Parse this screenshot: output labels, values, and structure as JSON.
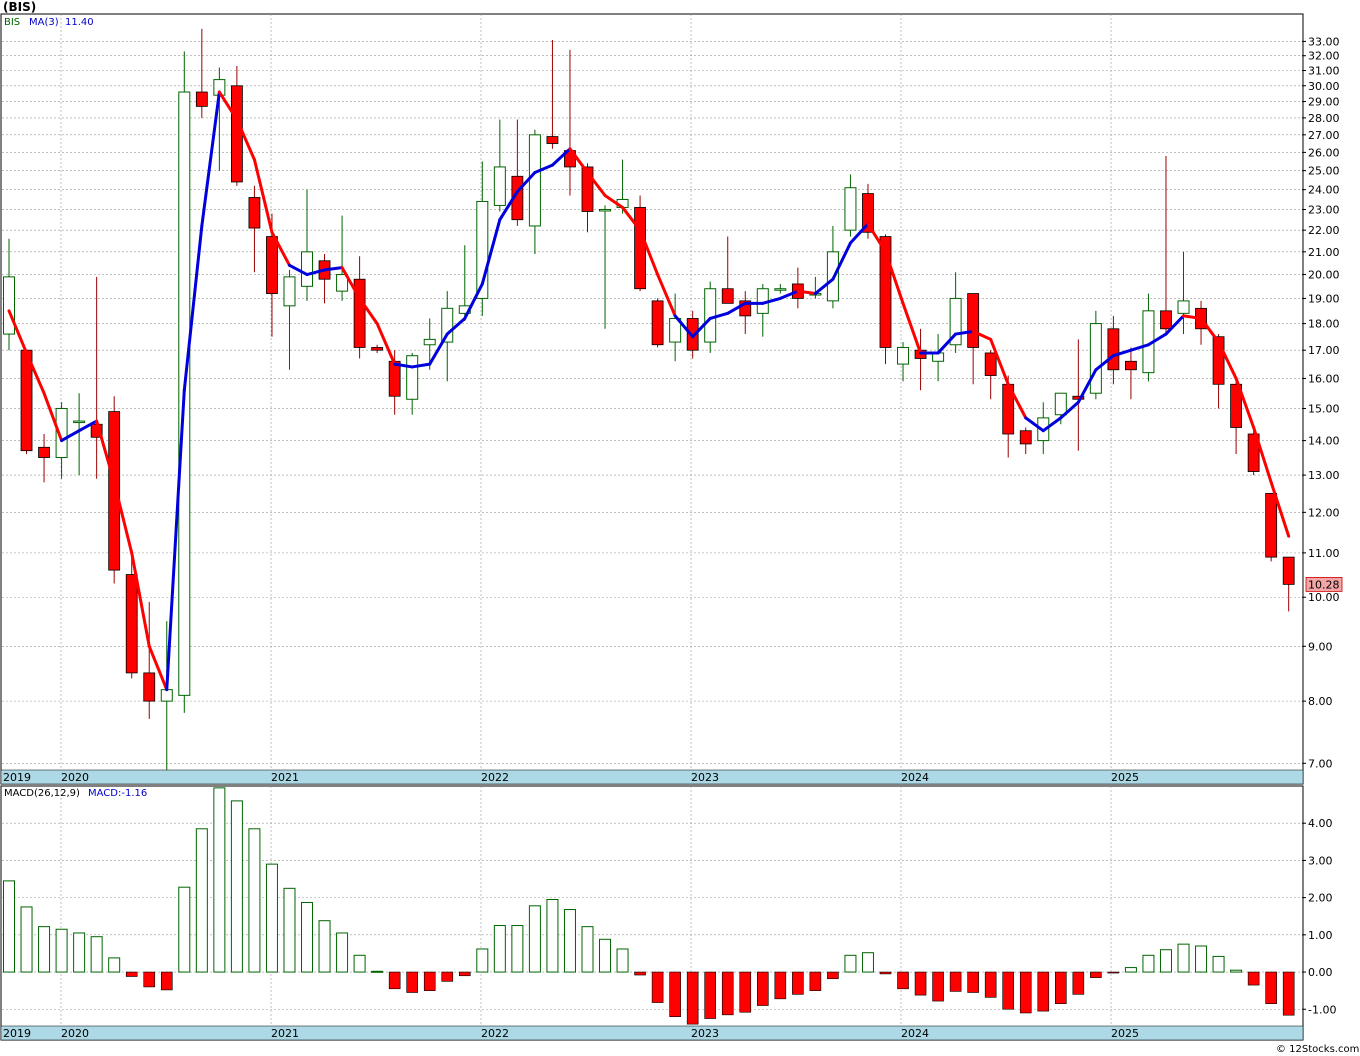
{
  "header": {
    "ticker": "(BIS)",
    "legend_symbol": "BIS",
    "legend_ma": "MA(3)",
    "legend_ma_value": "11.40",
    "macd_label": "MACD(26,12,9)",
    "macd_value_label": "MACD:-1.16",
    "last_price_tag": "10.28",
    "watermark": "© 12Stocks.com"
  },
  "colors": {
    "up_candle": "#006400",
    "down_candle": "#ff0000",
    "ma_up": "#0000dd",
    "ma_down": "#ff0000",
    "axis_band": "#add8e6",
    "grid": "#999999",
    "price_tag_bg": "#f4a6a6"
  },
  "chart_data": [
    {
      "type": "candlestick",
      "title": "(BIS)",
      "x_labels": [
        "2019",
        "2020",
        "2021",
        "2022",
        "2023",
        "2024",
        "2025"
      ],
      "y_scale": "log",
      "y_ticks": [
        "7.00",
        "8.00",
        "9.00",
        "10.00",
        "11.00",
        "12.00",
        "13.00",
        "14.00",
        "15.00",
        "16.00",
        "17.00",
        "18.00",
        "19.00",
        "20.00",
        "21.00",
        "22.00",
        "23.00",
        "24.00",
        "25.00",
        "26.00",
        "27.00",
        "28.00",
        "29.00",
        "30.00",
        "31.00",
        "32.00",
        "33.00"
      ],
      "ylim": [
        6.9,
        35
      ],
      "grid": true,
      "period": "monthly (approx.)",
      "candles": [
        {
          "o": 17.6,
          "h": 21.6,
          "l": 17.0,
          "c": 19.9
        },
        {
          "o": 17.0,
          "h": 17.0,
          "l": 13.6,
          "c": 13.7
        },
        {
          "o": 13.8,
          "h": 14.2,
          "l": 12.8,
          "c": 13.5
        },
        {
          "o": 13.5,
          "h": 15.2,
          "l": 12.9,
          "c": 15.0
        },
        {
          "o": 14.6,
          "h": 15.5,
          "l": 13.0,
          "c": 14.6
        },
        {
          "o": 14.5,
          "h": 19.9,
          "l": 12.9,
          "c": 14.1
        },
        {
          "o": 14.9,
          "h": 15.4,
          "l": 10.3,
          "c": 10.6
        },
        {
          "o": 10.5,
          "h": 11.0,
          "l": 8.4,
          "c": 8.5
        },
        {
          "o": 8.5,
          "h": 9.9,
          "l": 7.7,
          "c": 8.0
        },
        {
          "o": 8.0,
          "h": 9.5,
          "l": 6.9,
          "c": 8.2
        },
        {
          "o": 8.1,
          "h": 32.3,
          "l": 7.8,
          "c": 29.6
        },
        {
          "o": 29.6,
          "h": 33.9,
          "l": 28.0,
          "c": 28.7
        },
        {
          "o": 29.4,
          "h": 31.2,
          "l": 25.0,
          "c": 30.4
        },
        {
          "o": 30.0,
          "h": 31.3,
          "l": 24.2,
          "c": 24.4
        },
        {
          "o": 23.6,
          "h": 24.2,
          "l": 20.1,
          "c": 22.1
        },
        {
          "o": 21.7,
          "h": 22.8,
          "l": 17.5,
          "c": 19.2
        },
        {
          "o": 18.7,
          "h": 20.2,
          "l": 16.3,
          "c": 19.9
        },
        {
          "o": 19.5,
          "h": 24.0,
          "l": 18.9,
          "c": 21.0
        },
        {
          "o": 20.6,
          "h": 20.9,
          "l": 18.8,
          "c": 19.8
        },
        {
          "o": 19.3,
          "h": 22.7,
          "l": 18.9,
          "c": 20.0
        },
        {
          "o": 19.8,
          "h": 20.8,
          "l": 16.7,
          "c": 17.1
        },
        {
          "o": 17.1,
          "h": 17.2,
          "l": 16.9,
          "c": 17.0
        },
        {
          "o": 16.6,
          "h": 17.0,
          "l": 14.8,
          "c": 15.4
        },
        {
          "o": 15.3,
          "h": 16.9,
          "l": 14.8,
          "c": 16.8
        },
        {
          "o": 17.2,
          "h": 18.2,
          "l": 16.3,
          "c": 17.4
        },
        {
          "o": 17.3,
          "h": 19.3,
          "l": 15.9,
          "c": 18.6
        },
        {
          "o": 18.4,
          "h": 21.3,
          "l": 18.1,
          "c": 18.7
        },
        {
          "o": 19.0,
          "h": 25.5,
          "l": 18.3,
          "c": 23.4
        },
        {
          "o": 23.2,
          "h": 27.9,
          "l": 22.9,
          "c": 25.2
        },
        {
          "o": 24.7,
          "h": 27.9,
          "l": 22.2,
          "c": 22.5
        },
        {
          "o": 22.2,
          "h": 27.3,
          "l": 20.9,
          "c": 27.0
        },
        {
          "o": 26.9,
          "h": 33.1,
          "l": 26.2,
          "c": 26.5
        },
        {
          "o": 26.1,
          "h": 32.4,
          "l": 23.7,
          "c": 25.2
        },
        {
          "o": 25.2,
          "h": 25.4,
          "l": 21.9,
          "c": 22.9
        },
        {
          "o": 23.0,
          "h": 23.2,
          "l": 17.8,
          "c": 23.0
        },
        {
          "o": 23.1,
          "h": 25.6,
          "l": 22.8,
          "c": 23.5
        },
        {
          "o": 23.1,
          "h": 23.7,
          "l": 19.3,
          "c": 19.4
        },
        {
          "o": 18.9,
          "h": 19.0,
          "l": 17.1,
          "c": 17.2
        },
        {
          "o": 17.3,
          "h": 19.2,
          "l": 16.6,
          "c": 18.2
        },
        {
          "o": 18.2,
          "h": 18.5,
          "l": 16.7,
          "c": 17.0
        },
        {
          "o": 17.3,
          "h": 19.7,
          "l": 16.9,
          "c": 19.4
        },
        {
          "o": 19.4,
          "h": 21.7,
          "l": 18.8,
          "c": 18.8
        },
        {
          "o": 18.9,
          "h": 19.3,
          "l": 17.6,
          "c": 18.3
        },
        {
          "o": 18.4,
          "h": 19.6,
          "l": 17.5,
          "c": 19.4
        },
        {
          "o": 19.4,
          "h": 19.6,
          "l": 19.2,
          "c": 19.4
        },
        {
          "o": 19.6,
          "h": 20.3,
          "l": 18.6,
          "c": 19.0
        },
        {
          "o": 19.2,
          "h": 19.9,
          "l": 19.0,
          "c": 19.2
        },
        {
          "o": 18.9,
          "h": 22.2,
          "l": 18.6,
          "c": 21.0
        },
        {
          "o": 22.0,
          "h": 24.8,
          "l": 21.7,
          "c": 24.1
        },
        {
          "o": 23.8,
          "h": 24.3,
          "l": 21.6,
          "c": 21.9
        },
        {
          "o": 21.7,
          "h": 21.8,
          "l": 16.5,
          "c": 17.1
        },
        {
          "o": 16.5,
          "h": 17.3,
          "l": 15.9,
          "c": 17.1
        },
        {
          "o": 17.0,
          "h": 17.8,
          "l": 15.6,
          "c": 16.7
        },
        {
          "o": 16.6,
          "h": 17.6,
          "l": 15.9,
          "c": 16.9
        },
        {
          "o": 17.2,
          "h": 20.1,
          "l": 16.9,
          "c": 19.0
        },
        {
          "o": 19.2,
          "h": 19.2,
          "l": 15.8,
          "c": 17.1
        },
        {
          "o": 16.9,
          "h": 17.0,
          "l": 15.3,
          "c": 16.1
        },
        {
          "o": 15.8,
          "h": 16.1,
          "l": 13.5,
          "c": 14.2
        },
        {
          "o": 14.3,
          "h": 14.4,
          "l": 13.6,
          "c": 13.9
        },
        {
          "o": 14.0,
          "h": 15.2,
          "l": 13.6,
          "c": 14.7
        },
        {
          "o": 14.8,
          "h": 15.5,
          "l": 14.5,
          "c": 15.5
        },
        {
          "o": 15.4,
          "h": 17.4,
          "l": 13.7,
          "c": 15.3
        },
        {
          "o": 15.5,
          "h": 18.5,
          "l": 15.3,
          "c": 18.0
        },
        {
          "o": 17.8,
          "h": 18.3,
          "l": 15.8,
          "c": 16.3
        },
        {
          "o": 16.6,
          "h": 17.1,
          "l": 15.3,
          "c": 16.3
        },
        {
          "o": 16.2,
          "h": 19.2,
          "l": 15.9,
          "c": 18.5
        },
        {
          "o": 18.5,
          "h": 25.8,
          "l": 17.6,
          "c": 17.8
        },
        {
          "o": 18.4,
          "h": 21.0,
          "l": 17.6,
          "c": 18.9
        },
        {
          "o": 18.6,
          "h": 18.9,
          "l": 17.2,
          "c": 17.8
        },
        {
          "o": 17.5,
          "h": 17.6,
          "l": 15.0,
          "c": 15.8
        },
        {
          "o": 15.8,
          "h": 16.0,
          "l": 13.6,
          "c": 14.4
        },
        {
          "o": 14.2,
          "h": 14.3,
          "l": 13.0,
          "c": 13.1
        },
        {
          "o": 12.5,
          "h": 12.5,
          "l": 10.8,
          "c": 10.9
        },
        {
          "o": 10.9,
          "h": 10.9,
          "l": 9.7,
          "c": 10.28
        }
      ],
      "ma3": [
        18.5,
        16.9,
        15.5,
        14.0,
        14.3,
        14.6,
        12.8,
        11.0,
        9.0,
        8.2,
        15.6,
        22.2,
        29.6,
        27.9,
        25.6,
        21.9,
        20.4,
        20.0,
        20.2,
        20.3,
        19.0,
        18.0,
        16.5,
        16.4,
        16.5,
        17.6,
        18.2,
        19.6,
        22.5,
        23.9,
        24.9,
        25.3,
        26.2,
        24.9,
        23.7,
        23.1,
        22.0,
        20.0,
        18.3,
        17.5,
        18.2,
        18.4,
        18.8,
        18.8,
        19.0,
        19.3,
        19.2,
        19.8,
        21.4,
        22.3,
        21.0,
        18.8,
        16.9,
        16.9,
        17.6,
        17.7,
        17.4,
        15.8,
        14.7,
        14.3,
        14.7,
        15.2,
        16.3,
        16.8,
        17.0,
        17.2,
        17.6,
        18.3,
        18.2,
        17.3,
        16.0,
        14.4,
        12.8,
        11.4
      ],
      "ma3_up": [
        false,
        false,
        false,
        false,
        true,
        true,
        false,
        false,
        false,
        false,
        true,
        true,
        true,
        false,
        false,
        false,
        false,
        true,
        true,
        true,
        false,
        false,
        false,
        true,
        true,
        true,
        true,
        true,
        true,
        true,
        true,
        true,
        true,
        false,
        false,
        false,
        false,
        false,
        false,
        true,
        true,
        true,
        true,
        true,
        true,
        true,
        false,
        true,
        true,
        true,
        false,
        false,
        false,
        true,
        true,
        true,
        false,
        false,
        false,
        true,
        true,
        true,
        true,
        true,
        true,
        true,
        true,
        true,
        false,
        false,
        false,
        false,
        false,
        false
      ]
    },
    {
      "type": "bar",
      "title": "MACD(26,12,9)",
      "x_labels": [
        "2019",
        "2020",
        "2021",
        "2022",
        "2023",
        "2024",
        "2025"
      ],
      "y_ticks": [
        "-1.00",
        "0.00",
        "1.00",
        "2.00",
        "3.00",
        "4.00"
      ],
      "ylim": [
        -1.45,
        5.0
      ],
      "grid": true,
      "values": [
        2.45,
        1.75,
        1.22,
        1.15,
        1.05,
        0.95,
        0.38,
        -0.12,
        -0.4,
        -0.48,
        2.28,
        3.85,
        4.95,
        4.6,
        3.85,
        2.9,
        2.25,
        1.87,
        1.38,
        1.05,
        0.45,
        0.02,
        -0.45,
        -0.55,
        -0.5,
        -0.25,
        -0.1,
        0.62,
        1.25,
        1.25,
        1.78,
        1.95,
        1.68,
        1.22,
        0.88,
        0.62,
        -0.08,
        -0.82,
        -1.2,
        -1.4,
        -1.25,
        -1.15,
        -1.08,
        -0.9,
        -0.72,
        -0.6,
        -0.5,
        -0.18,
        0.45,
        0.52,
        -0.05,
        -0.45,
        -0.62,
        -0.78,
        -0.52,
        -0.55,
        -0.68,
        -1.0,
        -1.1,
        -1.05,
        -0.85,
        -0.6,
        -0.15,
        -0.02,
        0.12,
        0.45,
        0.6,
        0.75,
        0.7,
        0.42,
        0.05,
        -0.35,
        -0.85,
        -1.16
      ]
    }
  ]
}
